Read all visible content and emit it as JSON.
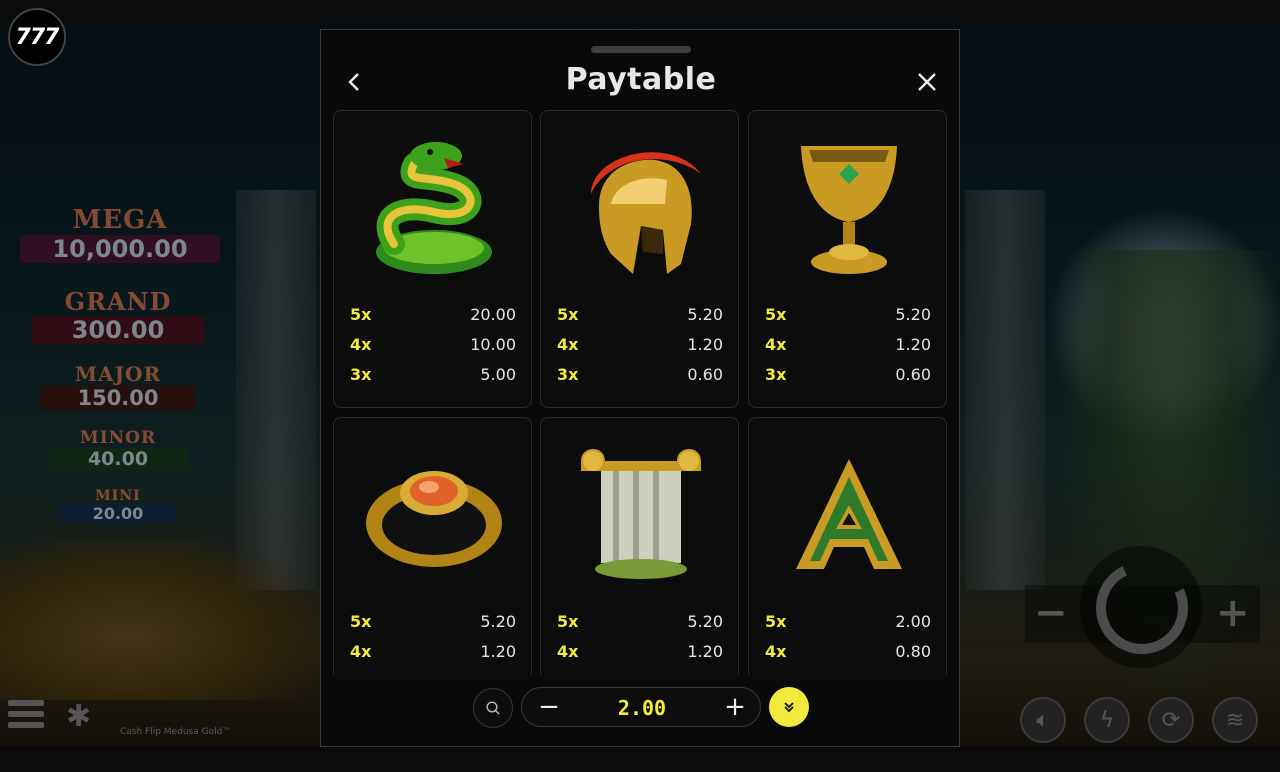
{
  "brand": {
    "logo_text": "777"
  },
  "background": {
    "jackpots": [
      {
        "name": "MEGA",
        "value": "10,000.00",
        "color": "#6a1740"
      },
      {
        "name": "GRAND",
        "value": "300.00",
        "color": "#7a1022"
      },
      {
        "name": "MAJOR",
        "value": "150.00",
        "color": "#5a1a10"
      },
      {
        "name": "MINOR",
        "value": "40.00",
        "color": "#1d4a1d"
      },
      {
        "name": "MINI",
        "value": "20.00",
        "color": "#15345a"
      }
    ],
    "game_title": "Cash Flip Medusa Gold™",
    "left_controls": [
      "menu-icon",
      "settings-puzzle-icon"
    ],
    "right_controls": [
      "volume-icon",
      "turbo-icon",
      "autoplay-icon",
      "coins-stack-icon"
    ]
  },
  "modal": {
    "title": "Paytable",
    "back_label": "‹",
    "close_label": "✕",
    "symbols": [
      {
        "icon": "snake-icon",
        "pays": [
          {
            "mult": "5x",
            "value": "20.00"
          },
          {
            "mult": "4x",
            "value": "10.00"
          },
          {
            "mult": "3x",
            "value": "5.00"
          }
        ]
      },
      {
        "icon": "helmet-icon",
        "pays": [
          {
            "mult": "5x",
            "value": "5.20"
          },
          {
            "mult": "4x",
            "value": "1.20"
          },
          {
            "mult": "3x",
            "value": "0.60"
          }
        ]
      },
      {
        "icon": "chalice-icon",
        "pays": [
          {
            "mult": "5x",
            "value": "5.20"
          },
          {
            "mult": "4x",
            "value": "1.20"
          },
          {
            "mult": "3x",
            "value": "0.60"
          }
        ]
      },
      {
        "icon": "ring-icon",
        "pays": [
          {
            "mult": "5x",
            "value": "5.20"
          },
          {
            "mult": "4x",
            "value": "1.20"
          }
        ]
      },
      {
        "icon": "column-icon",
        "pays": [
          {
            "mult": "5x",
            "value": "5.20"
          },
          {
            "mult": "4x",
            "value": "1.20"
          }
        ]
      },
      {
        "icon": "letter-a-icon",
        "pays": [
          {
            "mult": "5x",
            "value": "2.00"
          },
          {
            "mult": "4x",
            "value": "0.80"
          }
        ]
      }
    ],
    "letter_a_glyph": "A"
  },
  "footer": {
    "bet_value": "2.00",
    "minus_label": "−",
    "plus_label": "+",
    "accent_color": "#f2ea3c"
  }
}
